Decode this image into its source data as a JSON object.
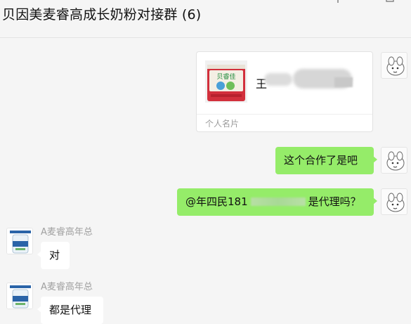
{
  "header": {
    "title": "贝因美麦睿高成长奶粉对接群 (6)",
    "icons": [
      "add-member-icon",
      "more-icon"
    ]
  },
  "contact_card": {
    "product_text": "贝睿佳",
    "name_visible": "王",
    "label": "个人名片"
  },
  "messages": [
    {
      "side": "right",
      "text": "这个合作了是吧"
    },
    {
      "side": "right",
      "text_start": "@年四民181",
      "text_end": "是代理吗？"
    },
    {
      "side": "left",
      "sender": "A麦睿高年总",
      "text": "对"
    },
    {
      "side": "left",
      "sender": "A麦睿高年总",
      "text": "都是代理"
    }
  ],
  "colors": {
    "background": "#f5f5f5",
    "self_bubble": "#95ec69",
    "other_bubble": "#ffffff",
    "product_red": "#d2303c"
  }
}
